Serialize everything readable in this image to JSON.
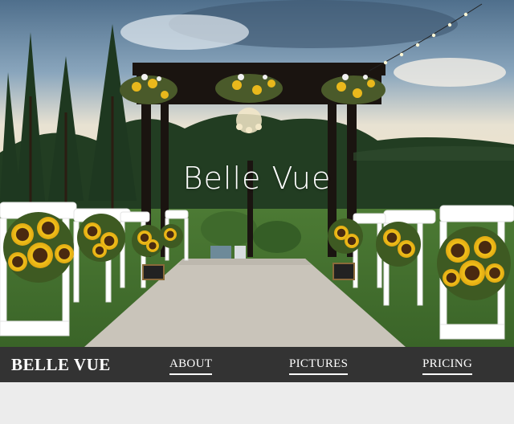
{
  "hero": {
    "title": "Belle Vue",
    "image_description_icon": "wedding-venue-photo"
  },
  "navbar": {
    "brand": "BELLE VUE",
    "links": [
      {
        "label": "ABOUT"
      },
      {
        "label": "PICTURES"
      },
      {
        "label": "PRICING"
      }
    ]
  },
  "colors": {
    "navbar_bg": "#333333",
    "nav_text": "#ffffff",
    "page_bg": "#ececec"
  }
}
